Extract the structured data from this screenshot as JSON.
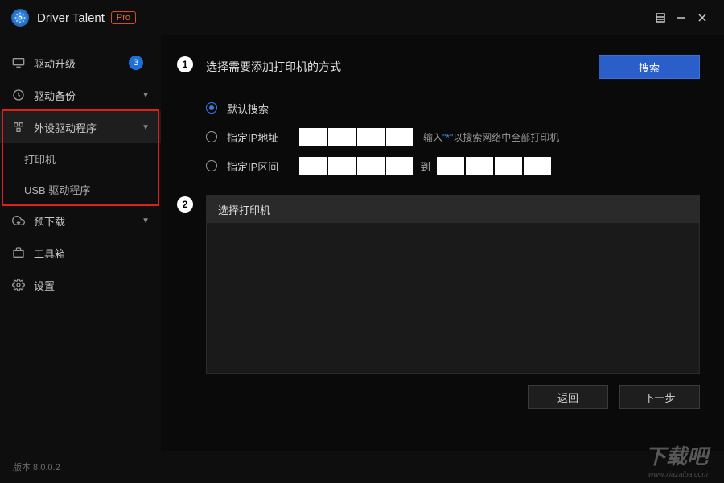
{
  "app": {
    "title": "Driver Talent",
    "pro": "Pro"
  },
  "sidebar": {
    "items": [
      {
        "label": "驱动升级",
        "badge": "3"
      },
      {
        "label": "驱动备份"
      },
      {
        "label": "外设驱动程序"
      },
      {
        "label": "打印机"
      },
      {
        "label": "USB 驱动程序"
      },
      {
        "label": "预下载"
      },
      {
        "label": "工具箱"
      },
      {
        "label": "设置"
      }
    ]
  },
  "step1": {
    "title": "选择需要添加打印机的方式",
    "search": "搜索",
    "opt_default": "默认搜索",
    "opt_ip": "指定IP地址",
    "opt_range": "指定IP区间",
    "range_sep": "到",
    "hint_pre": "输入",
    "hint_quote": "\"*\"",
    "hint_post": "以搜索网络中全部打印机"
  },
  "step2": {
    "title": "选择打印机"
  },
  "buttons": {
    "back": "返回",
    "next": "下一步"
  },
  "footer": {
    "version": "版本 8.0.0.2"
  },
  "watermark": {
    "main": "下载吧",
    "sub": "www.xiazaiba.com"
  }
}
